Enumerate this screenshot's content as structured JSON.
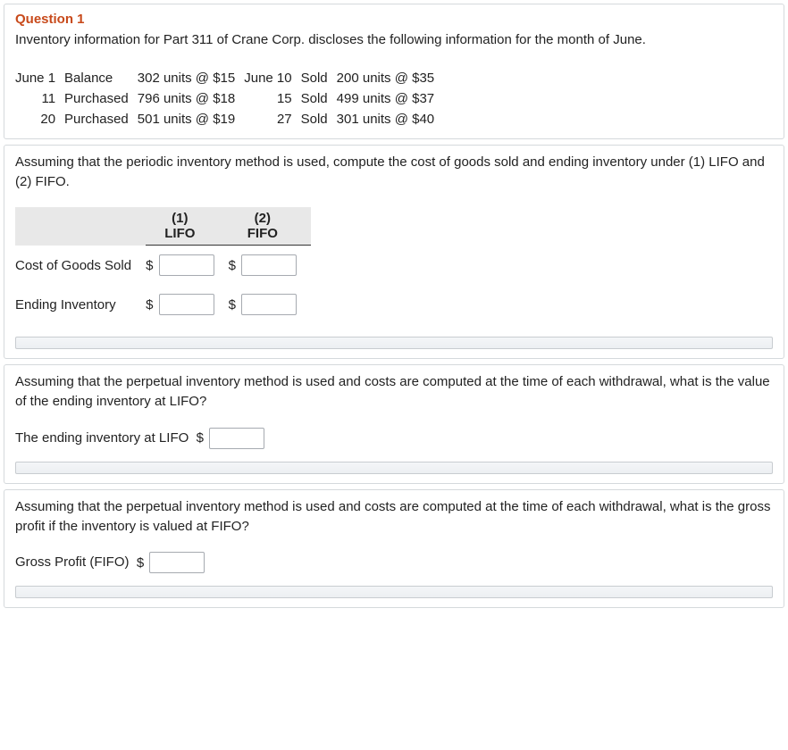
{
  "question_label": "Question 1",
  "intro": "Inventory information for Part 311 of Crane Corp. discloses the following information for the month of June.",
  "inv": {
    "r1": {
      "d1": "June 1",
      "a1": "Balance",
      "q1": "302 units @ $15",
      "d2": "June 10",
      "a2": "Sold",
      "q2": "200 units @ $35"
    },
    "r2": {
      "d1": "11",
      "a1": "Purchased",
      "q1": "796 units @ $18",
      "d2": "15",
      "a2": "Sold",
      "q2": "499 units @ $37"
    },
    "r3": {
      "d1": "20",
      "a1": "Purchased",
      "q1": "501 units @ $19",
      "d2": "27",
      "a2": "Sold",
      "q2": "301 units @ $40"
    }
  },
  "p2": {
    "instruction": "Assuming that the periodic inventory method is used, compute the cost of goods sold and ending inventory under (1) LIFO and (2) FIFO.",
    "col1_top": "(1)",
    "col1_bot": "LIFO",
    "col2_top": "(2)",
    "col2_bot": "FIFO",
    "row1": "Cost of Goods Sold",
    "row2": "Ending Inventory",
    "currency": "$"
  },
  "p3": {
    "instruction": "Assuming that the perpetual inventory method is used and costs are computed at the time of each withdrawal, what is the value of the ending inventory at LIFO?",
    "label": "The ending inventory at LIFO",
    "currency": "$"
  },
  "p4": {
    "instruction": "Assuming that the perpetual inventory method is used and costs are computed at the time of each withdrawal, what is the gross profit if the inventory is valued at FIFO?",
    "label": "Gross Profit (FIFO)",
    "currency": "$"
  }
}
